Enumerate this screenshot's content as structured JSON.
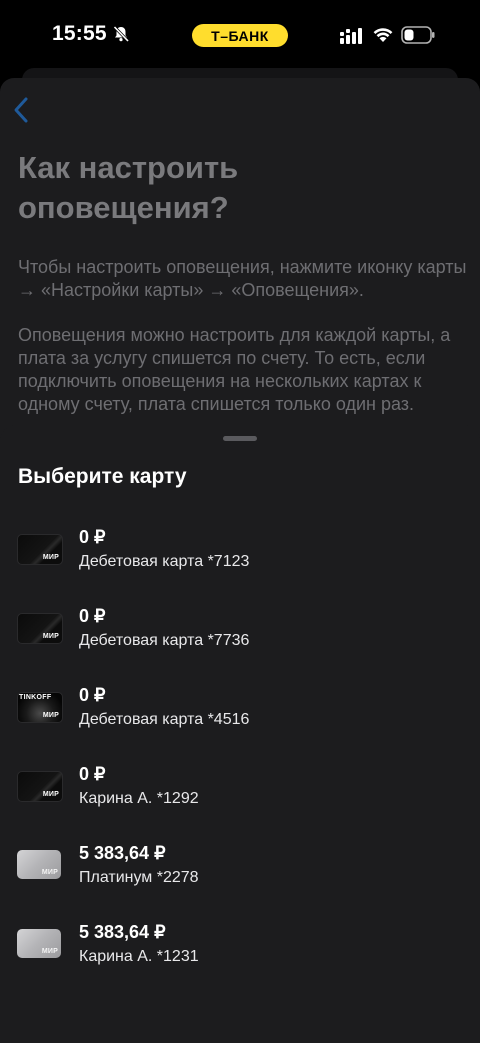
{
  "status_bar": {
    "time": "15:55",
    "bank_pill": "Т–БАНК",
    "colors": {
      "pill": "#ffdd2d"
    },
    "icons": [
      "bell-off-icon",
      "cellular-signal-icon",
      "wifi-icon",
      "battery-icon"
    ]
  },
  "background_page": {
    "title": "Как настроить оповещения?",
    "paragraph1": "Чтобы настроить оповещения, нажмите иконку карты → «Настройки карты» → «Оповещения».",
    "paragraph2": "Оповещения можно настроить для каждой карты, а плата за услугу спишется по счету. То есть, если подключить оповещения на нескольких картах к одному счету, плата спишется только один раз."
  },
  "sheet": {
    "title": "Выберите карту",
    "cards": [
      {
        "amount": "0 ₽",
        "name": "Дебетовая карта *7123",
        "style": "dark",
        "mir": "МИР"
      },
      {
        "amount": "0 ₽",
        "name": "Дебетовая карта *7736",
        "style": "dark",
        "mir": "МИР"
      },
      {
        "amount": "0 ₽",
        "name": "Дебетовая карта *4516",
        "style": "tinkoff",
        "mir": "МИР",
        "brand": "TINKOFF"
      },
      {
        "amount": "0 ₽",
        "name": "Карина А. *1292",
        "style": "dark",
        "mir": "МИР"
      },
      {
        "amount": "5 383,64 ₽",
        "name": "Платинум *2278",
        "style": "silver",
        "mir": "МИР"
      },
      {
        "amount": "5 383,64 ₽",
        "name": "Карина А. *1231",
        "style": "silver",
        "mir": "МИР"
      }
    ]
  }
}
